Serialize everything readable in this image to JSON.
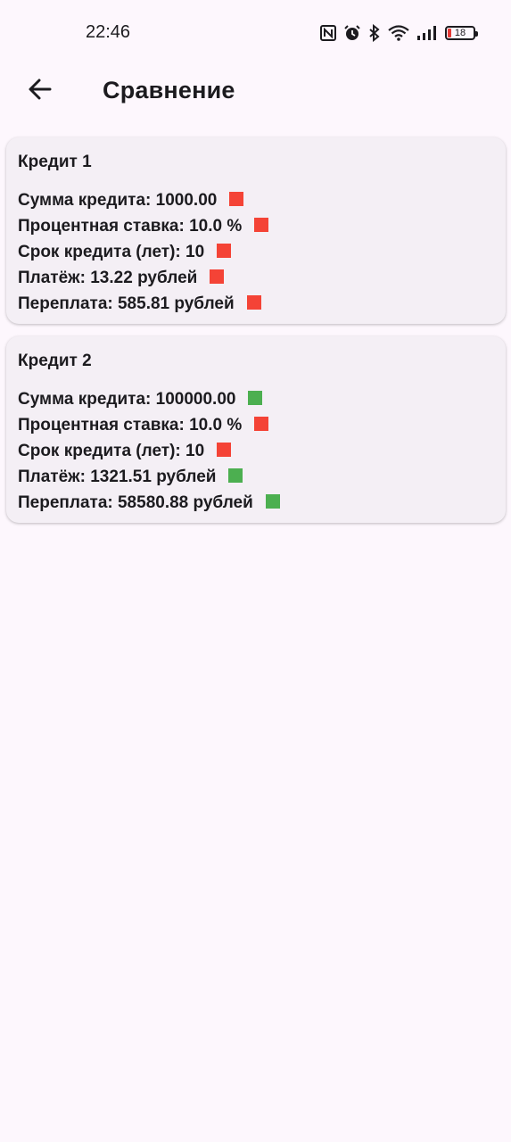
{
  "status_bar": {
    "time": "22:46",
    "battery_level": "18",
    "icons": [
      "nfc-icon",
      "alarm-icon",
      "bluetooth-icon",
      "wifi-icon",
      "signal-icon",
      "battery-icon"
    ]
  },
  "app_bar": {
    "title": "Сравнение",
    "back_icon": "arrow-left-icon"
  },
  "colors": {
    "worse": "#f44336",
    "better": "#4caf50"
  },
  "cards": [
    {
      "title": "Кредит 1",
      "rows": [
        {
          "text": "Сумма кредита: 1000.00",
          "indicator": "red"
        },
        {
          "text": "Процентная ставка: 10.0 %",
          "indicator": "red"
        },
        {
          "text": "Срок кредита (лет): 10",
          "indicator": "red"
        },
        {
          "text": "Платёж: 13.22 рублей",
          "indicator": "red"
        },
        {
          "text": "Переплата: 585.81 рублей",
          "indicator": "red"
        }
      ]
    },
    {
      "title": "Кредит 2",
      "rows": [
        {
          "text": "Сумма кредита: 100000.00",
          "indicator": "green"
        },
        {
          "text": "Процентная ставка: 10.0 %",
          "indicator": "red"
        },
        {
          "text": "Срок кредита (лет): 10",
          "indicator": "red"
        },
        {
          "text": "Платёж: 1321.51 рублей",
          "indicator": "green"
        },
        {
          "text": "Переплата: 58580.88 рублей",
          "indicator": "green"
        }
      ]
    }
  ]
}
